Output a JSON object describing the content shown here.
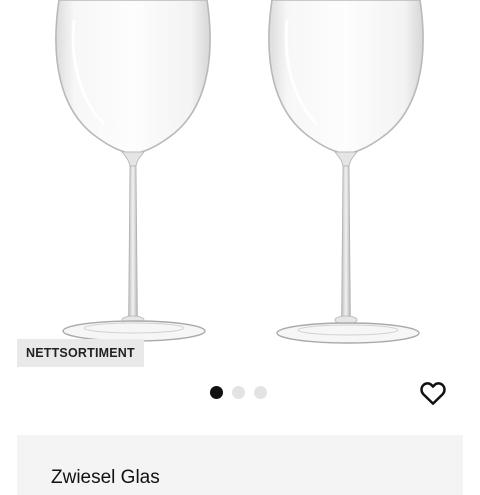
{
  "product": {
    "badge": "NETTSORTIMENT",
    "brand": "Zwiesel Glas",
    "image_icon": "wine-glass-pair"
  },
  "gallery": {
    "total_images": 3,
    "active_index": 0
  },
  "favorite": {
    "icon": "heart-outline-icon"
  },
  "colors": {
    "active_dot": "#111111",
    "inactive_dot": "#e3e3e3",
    "badge_bg": "#e9e9e9",
    "card_bg": "#f4f4f4"
  }
}
